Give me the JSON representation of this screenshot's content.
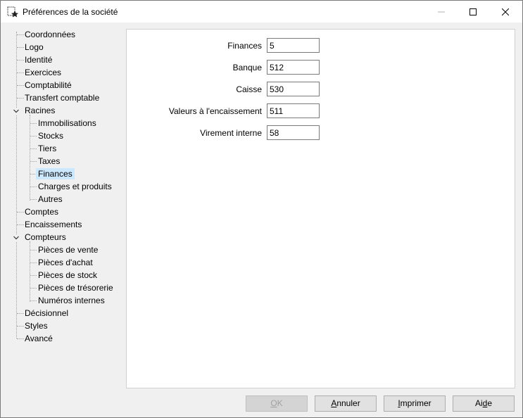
{
  "window": {
    "title": "Préférences de la société"
  },
  "tree": {
    "items": {
      "coordonnees": "Coordonnées",
      "logo": "Logo",
      "identite": "Identité",
      "exercices": "Exercices",
      "comptabilite": "Comptabilité",
      "transfert": "Transfert comptable",
      "racines": "Racines",
      "immobilisations": "Immobilisations",
      "stocks": "Stocks",
      "tiers": "Tiers",
      "taxes": "Taxes",
      "finances": "Finances",
      "charges": "Charges et produits",
      "autres": "Autres",
      "comptes": "Comptes",
      "encaissements": "Encaissements",
      "compteurs": "Compteurs",
      "pieces_vente": "Pièces de vente",
      "pieces_achat": "Pièces d'achat",
      "pieces_stock": "Pièces de stock",
      "pieces_tresorerie": "Pièces de trésorerie",
      "numeros_internes": "Numéros internes",
      "decisionnel": "Décisionnel",
      "styles": "Styles",
      "avance": "Avancé"
    },
    "selected": "Finances"
  },
  "form": {
    "finances": {
      "label": "Finances",
      "value": "5"
    },
    "banque": {
      "label": "Banque",
      "value": "512"
    },
    "caisse": {
      "label": "Caisse",
      "value": "530"
    },
    "valeurs": {
      "label": "Valeurs à l'encaissement",
      "value": "511"
    },
    "virement": {
      "label": "Virement interne",
      "value": "58"
    }
  },
  "buttons": {
    "ok": {
      "pre": "",
      "key": "O",
      "post": "K"
    },
    "annuler": {
      "pre": "",
      "key": "A",
      "post": "nnuler"
    },
    "imprimer": {
      "pre": "",
      "key": "I",
      "post": "mprimer"
    },
    "aide": {
      "pre": "Ai",
      "key": "d",
      "post": "e"
    }
  }
}
